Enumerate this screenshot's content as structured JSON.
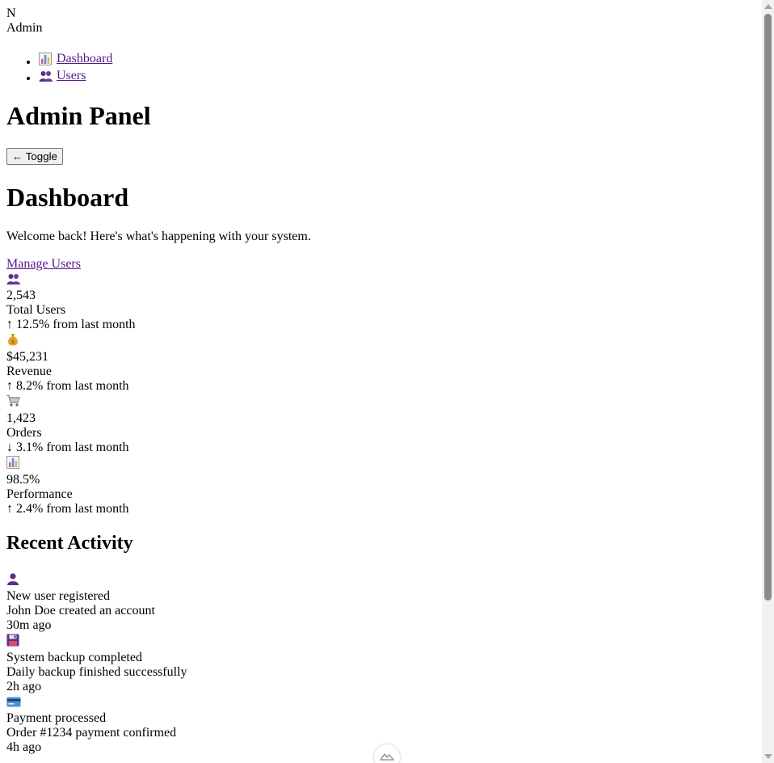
{
  "brand": {
    "logo_letter": "N",
    "name": "Admin"
  },
  "nav": {
    "items": [
      {
        "label": "Dashboard",
        "icon": "bar-chart-icon"
      },
      {
        "label": "Users",
        "icon": "users-icon"
      }
    ]
  },
  "header": {
    "title": "Admin Panel",
    "toggle_label": "← Toggle"
  },
  "main": {
    "title": "Dashboard",
    "subtitle": "Welcome back! Here's what's happening with your system.",
    "manage_users_label": "Manage Users"
  },
  "stats": [
    {
      "icon": "users-icon",
      "value": "2,543",
      "label": "Total Users",
      "change": "↑ 12.5% from last month",
      "trend": "up"
    },
    {
      "icon": "money-bag-icon",
      "value": "$45,231",
      "label": "Revenue",
      "change": "↑ 8.2% from last month",
      "trend": "up"
    },
    {
      "icon": "shopping-cart-icon",
      "value": "1,423",
      "label": "Orders",
      "change": "↓ 3.1% from last month",
      "trend": "down"
    },
    {
      "icon": "bar-chart-icon",
      "value": "98.5%",
      "label": "Performance",
      "change": "↑ 2.4% from last month",
      "trend": "up"
    }
  ],
  "activity": {
    "title": "Recent Activity",
    "items": [
      {
        "icon": "user-icon",
        "title": "New user registered",
        "detail": "John Doe created an account",
        "time": "30m ago"
      },
      {
        "icon": "floppy-disk-icon",
        "title": "System backup completed",
        "detail": "Daily backup finished successfully",
        "time": "2h ago"
      },
      {
        "icon": "credit-card-icon",
        "title": "Payment processed",
        "detail": "Order #1234 payment confirmed",
        "time": "4h ago"
      }
    ]
  },
  "colors": {
    "link": "#551a8b",
    "text": "#000000",
    "background": "#ffffff",
    "emoji_purple": "#5b2d8a"
  }
}
